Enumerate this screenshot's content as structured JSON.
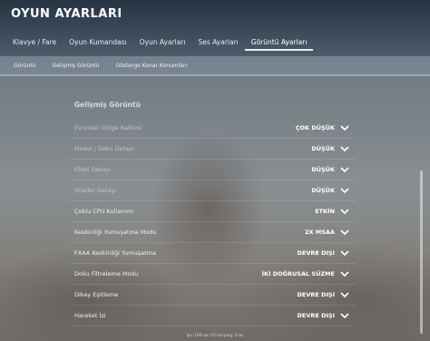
{
  "header": {
    "title": "OYUN AYARLARI"
  },
  "tabs": [
    {
      "label": "Klavye / Fare"
    },
    {
      "label": "Oyun Kumandası"
    },
    {
      "label": "Oyun Ayarları"
    },
    {
      "label": "Ses Ayarları"
    },
    {
      "label": "Görüntü Ayarları",
      "active": true
    }
  ],
  "subtabs": [
    {
      "label": "Görüntü"
    },
    {
      "label": "Gelişmiş Görüntü"
    },
    {
      "label": "Gösterge Konar Konumları"
    }
  ],
  "section": {
    "title": "Gelişmiş Görüntü"
  },
  "settings": [
    {
      "label": "Evrensel Gölge Kalitesi",
      "value": "ÇOK DÜŞÜK",
      "dim": true
    },
    {
      "label": "Model / Doku Detayı",
      "value": "DÜŞÜK",
      "dim": true
    },
    {
      "label": "Efekt Detayı",
      "value": "DÜŞÜK",
      "dim": true
    },
    {
      "label": "Shader Detayı",
      "value": "DÜŞÜK",
      "dim": true
    },
    {
      "label": "Çoklu CPU Kullanımı",
      "value": "ETKİN",
      "dim": false
    },
    {
      "label": "Keskinliği Yumuşatma Modu",
      "value": "2X MSAA",
      "dim": false
    },
    {
      "label": "FXAA Keskinliği Yumuşatma",
      "value": "DEVRE DIŞI",
      "dim": false
    },
    {
      "label": "Doku Filtreleme Modu",
      "value": "İKİ DOĞRUSAL SÜZME",
      "dim": false
    },
    {
      "label": "Dikey Eşitleme",
      "value": "DEVRE DIŞI",
      "dim": false
    },
    {
      "label": "Hareket İzi",
      "value": "DEVRE DIŞI",
      "dim": false
    }
  ],
  "footer": {
    "text": "fps: 108 var: 0.0 ms ping: 0 ms"
  },
  "icons": {
    "row_dropdown": "chevron-down-icon"
  }
}
